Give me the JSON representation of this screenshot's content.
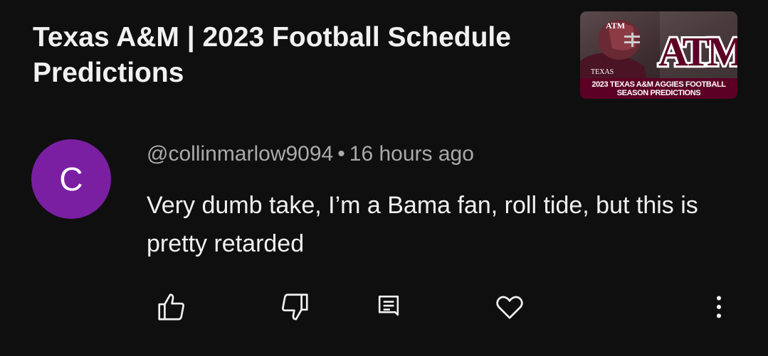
{
  "video": {
    "title": "Texas A&M | 2023 Football Schedule Predictions",
    "thumbnail": {
      "logo_text": "ATM",
      "jersey_text": "TEXAS",
      "caption_line1": "2023 TEXAS A&M AGGIES FOOTBALL",
      "caption_line2": "SEASON PREDICTIONS",
      "accent_color": "#5c0025"
    }
  },
  "comment": {
    "avatar_letter": "C",
    "avatar_color": "#7b1fa2",
    "author": "@collinmarlow9094",
    "separator": "•",
    "time": "16 hours ago",
    "text": "Very dumb take, I’m a Bama fan, roll tide, but this is pretty retarded"
  },
  "actions": {
    "icons": [
      "thumbs-up-icon",
      "thumbs-down-icon",
      "reply-icon",
      "heart-icon",
      "more-vert-icon"
    ]
  }
}
